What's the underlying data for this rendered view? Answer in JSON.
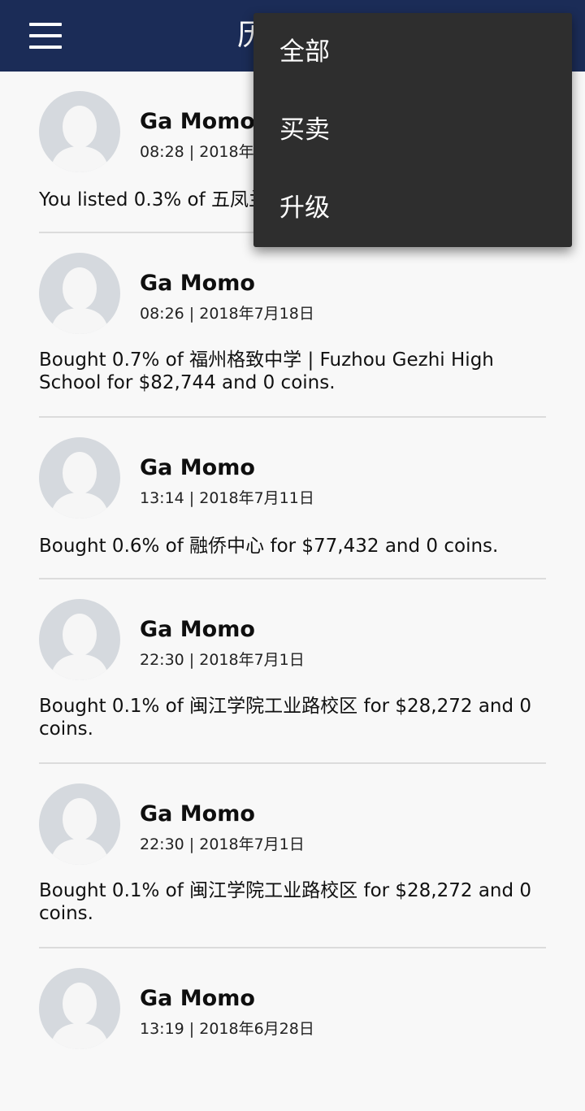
{
  "header": {
    "title": "历史"
  },
  "menu": {
    "items": [
      "全部",
      "买卖",
      "升级"
    ]
  },
  "feed": [
    {
      "name": "Ga Momo",
      "time": "08:28 | 2018年7月18日",
      "text": "You listed 0.3% of 五凤兰"
    },
    {
      "name": "Ga Momo",
      "time": "08:26 | 2018年7月18日",
      "text": "Bought 0.7% of 福州格致中学 | Fuzhou Gezhi High School for $82,744 and 0 coins."
    },
    {
      "name": "Ga Momo",
      "time": "13:14 | 2018年7月11日",
      "text": "Bought 0.6% of 融侨中心 for $77,432 and 0 coins."
    },
    {
      "name": "Ga Momo",
      "time": "22:30 | 2018年7月1日",
      "text": "Bought 0.1% of 闽江学院工业路校区 for $28,272 and 0 coins."
    },
    {
      "name": "Ga Momo",
      "time": "22:30 | 2018年7月1日",
      "text": "Bought 0.1% of 闽江学院工业路校区 for $28,272 and 0 coins."
    },
    {
      "name": "Ga Momo",
      "time": "13:19 | 2018年6月28日",
      "text": ""
    }
  ]
}
